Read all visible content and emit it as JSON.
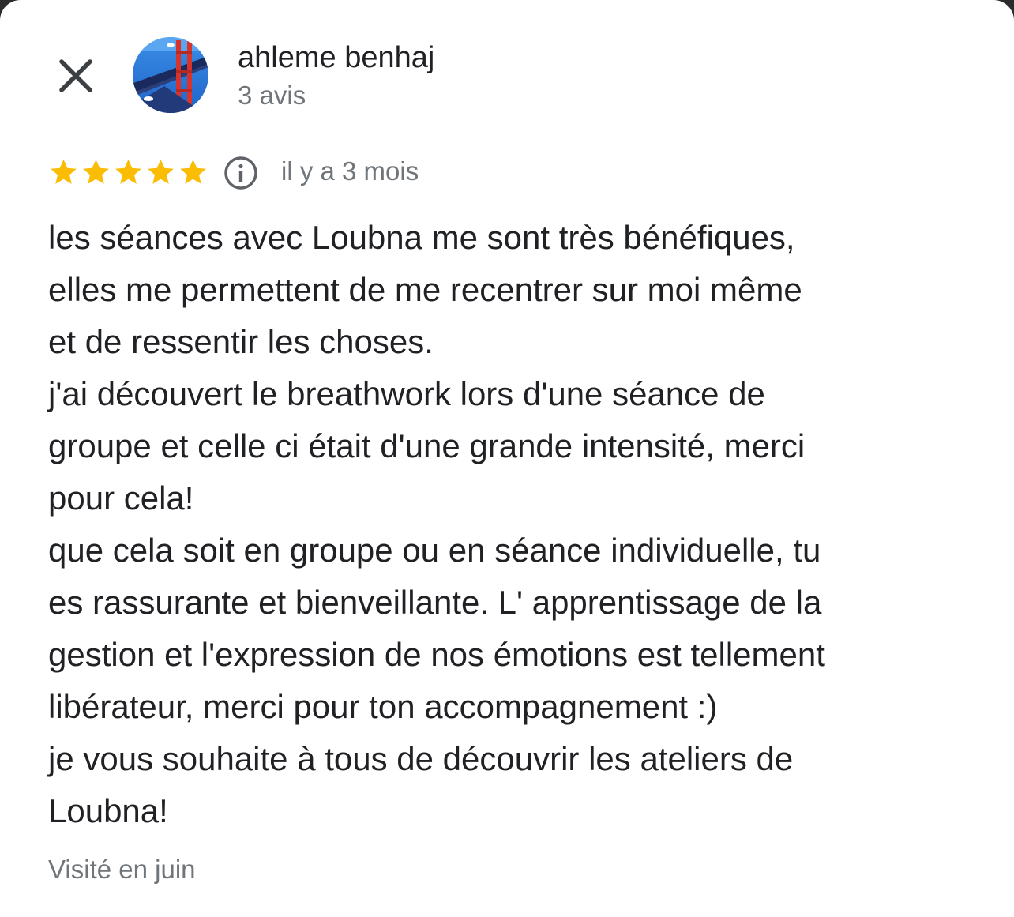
{
  "reviewer": {
    "name": "ahleme benhaj",
    "review_count": "3 avis"
  },
  "review": {
    "rating": 5,
    "rating_max": 5,
    "time_ago": "il y a 3 mois",
    "lines": [
      "les séances avec Loubna me sont très bénéfiques,",
      "elles me permettent de me recentrer sur moi même",
      "et de ressentir les choses.",
      "j'ai découvert le breathwork lors d'une séance de",
      "groupe et celle ci était d'une grande intensité, merci",
      "pour cela!",
      "que cela soit en groupe ou en séance individuelle, tu",
      "es rassurante et bienveillante. L' apprentissage de la",
      "gestion et l'expression de nos émotions est tellement",
      "libérateur, merci pour ton accompagnement :)",
      "je vous souhaite à tous de découvrir les ateliers de",
      "Loubna!"
    ],
    "visited": "Visité en juin"
  },
  "icons": {
    "close": "close-icon",
    "info": "info-icon",
    "star": "star-icon"
  },
  "colors": {
    "star": "#fbbc04",
    "primary_text": "#202124",
    "secondary_text": "#70757a",
    "icon": "#5f6368"
  }
}
